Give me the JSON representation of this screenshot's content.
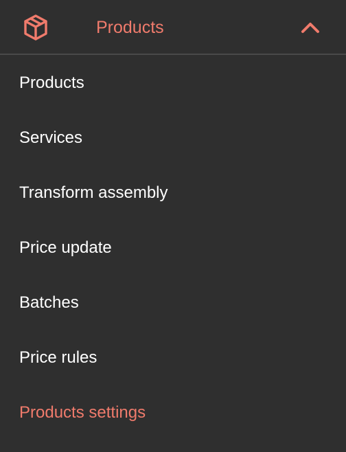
{
  "header": {
    "title": "Products",
    "icon": "box-icon",
    "toggle_icon": "chevron-up-icon",
    "accent_color": "#f07b6c"
  },
  "items": [
    {
      "label": "Products"
    },
    {
      "label": "Services"
    },
    {
      "label": "Transform assembly"
    },
    {
      "label": "Price update"
    },
    {
      "label": "Batches"
    },
    {
      "label": "Price rules"
    },
    {
      "label": "Products settings",
      "active": true
    }
  ],
  "colors": {
    "background": "#2f2f2f",
    "text": "#ffffff",
    "accent": "#f07b6c",
    "divider": "#4a4a4a"
  }
}
